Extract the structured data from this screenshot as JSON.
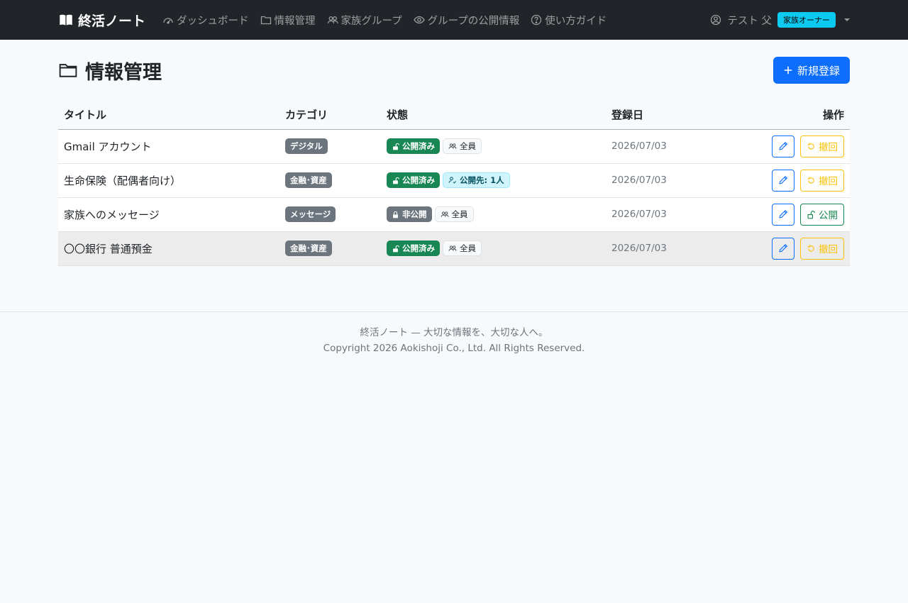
{
  "colors": {
    "navbar_bg": "#212529",
    "primary": "#0d6efd",
    "success": "#198754",
    "warning": "#ffc107",
    "secondary": "#6c757d",
    "info": "#0dcaf0"
  },
  "nav": {
    "brand": "終活ノート",
    "brand_icon": "book-icon",
    "items": [
      {
        "label": "ダッシュボード",
        "icon": "speedometer-icon"
      },
      {
        "label": "情報管理",
        "icon": "folder-icon"
      },
      {
        "label": "家族グループ",
        "icon": "people-icon"
      },
      {
        "label": "グループの公開情報",
        "icon": "eye-icon"
      },
      {
        "label": "使い方ガイド",
        "icon": "question-circle-icon"
      }
    ],
    "user": {
      "name": "テスト 父",
      "role_badge": "家族オーナー",
      "icon": "person-circle-icon"
    }
  },
  "page": {
    "title": "情報管理",
    "title_icon": "folder-icon",
    "new_button": "新規登録"
  },
  "table": {
    "headers": {
      "title": "タイトル",
      "category": "カテゴリ",
      "status": "状態",
      "date": "登録日",
      "actions": "操作"
    },
    "rows": [
      {
        "title": "Gmail アカウント",
        "category": "デジタル",
        "status": "公開済み",
        "status_type": "public",
        "audience": "全員",
        "audience_type": "all",
        "date": "2026/07/03",
        "action": "撤回",
        "action_type": "revoke"
      },
      {
        "title": "生命保険（配偶者向け）",
        "category": "金融･資産",
        "status": "公開済み",
        "status_type": "public",
        "audience": "公開先: 1人",
        "audience_type": "specific",
        "date": "2026/07/03",
        "action": "撤回",
        "action_type": "revoke"
      },
      {
        "title": "家族へのメッセージ",
        "category": "メッセージ",
        "status": "非公開",
        "status_type": "private",
        "audience": "全員",
        "audience_type": "all",
        "date": "2026/07/03",
        "action": "公開",
        "action_type": "publish"
      },
      {
        "title": "〇〇銀行 普通預金",
        "category": "金融･資産",
        "status": "公開済み",
        "status_type": "public",
        "audience": "全員",
        "audience_type": "all",
        "date": "2026/07/03",
        "action": "撤回",
        "action_type": "revoke"
      }
    ]
  },
  "footer": {
    "tagline": "終活ノート — 大切な情報を、大切な人へ。",
    "copyright": "Copyright 2026 Aokishoji Co., Ltd. All Rights Reserved."
  }
}
